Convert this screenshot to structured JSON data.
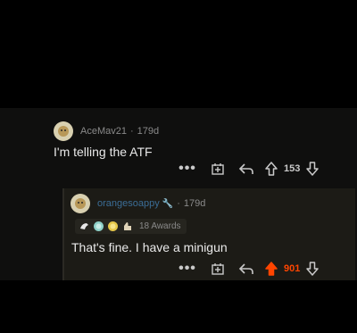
{
  "comment": {
    "username": "AceMav21",
    "separator": "·",
    "age": "179d",
    "body": "I'm telling the ATF",
    "more_label": "•••",
    "vote_count": "153",
    "icons": [
      "avatar",
      "more-icon",
      "award-icon",
      "reply-icon",
      "upvote-icon",
      "downvote-icon"
    ]
  },
  "reply": {
    "username": "orangesoappy",
    "separator": "·",
    "age": "179d",
    "mod_icon": "🔧",
    "awards_label": "18 Awards",
    "award_icons": [
      "wholesome-icon",
      "silver-icon",
      "gold-icon",
      "helpful-icon"
    ],
    "body": "That's fine. I have a minigun",
    "more_label": "•••",
    "vote_count": "901",
    "upvote_color": "#ff4500"
  },
  "colors": {
    "background": "#000000",
    "panel": "#0f0f0e",
    "reply_card": "#1c1b16",
    "text": "#e9e9e9",
    "meta": "#8a8a8a",
    "reply_username": "#3b6d96"
  }
}
